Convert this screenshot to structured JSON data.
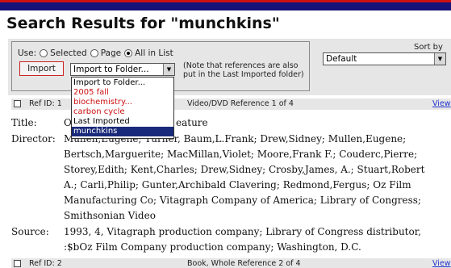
{
  "page": {
    "title": "Search Results for \"munchkins\""
  },
  "options": {
    "use_label": "Use:",
    "radio_selected": "Selected",
    "radio_page": "Page",
    "radio_all": "All in List",
    "import_button": "Import",
    "folder_select_value": "Import to Folder...",
    "note": "(Note that references are also put in the Last Imported folder)",
    "sort_label": "Sort by",
    "sort_value": "Default"
  },
  "folder_dropdown": {
    "items": [
      {
        "label": "Import to Folder...",
        "style": "normal"
      },
      {
        "label": "2005 fall",
        "style": "red"
      },
      {
        "label": "biochemistry...",
        "style": "red"
      },
      {
        "label": "carbon cycle",
        "style": "red"
      },
      {
        "label": "Last Imported",
        "style": "normal"
      },
      {
        "label": "munchkins",
        "style": "selected"
      }
    ]
  },
  "references": [
    {
      "ref_id": "Ref ID: 1",
      "type": "Video/DVD Reference 1 of 4",
      "view": "View",
      "title_label": "Title:",
      "title_lines": [
        "O",
        "eature"
      ],
      "director_label": "Director:",
      "director_lines": [
        "Mullen,Eugene; Turner, Baum,L.Frank; Drew,Sidney; Mullen,Eugene;",
        "Bertsch,Marguerite; MacMillan,Violet; Moore,Frank F.; Couderc,Pierre;",
        "Storey,Edith; Kent,Charles; Drew,Sidney; Crosby,James, A.; Stuart,Robert",
        "A.; Carli,Philip; Gunter,Archibald Clavering; Redmond,Fergus; Oz Film",
        "Manufacturing Co; Vitagraph Company of America; Library of Congress;",
        "Smithsonian Video"
      ],
      "source_label": "Source:",
      "source_lines": [
        "1993, 4, Vitagraph production company; Library of Congress distributor,",
        ":$bOz Film Company production company; Washington, D.C."
      ]
    },
    {
      "ref_id": "Ref ID: 2",
      "type": "Book, Whole Reference 2 of 4",
      "view": "View"
    }
  ],
  "colors": {
    "top_red": "#cc1111",
    "top_blue": "#16127a",
    "panel_gray": "#e6e6e6",
    "red_item": "#cc1111",
    "selected_item_bg": "#1a2a7a",
    "link": "#2233cc"
  }
}
